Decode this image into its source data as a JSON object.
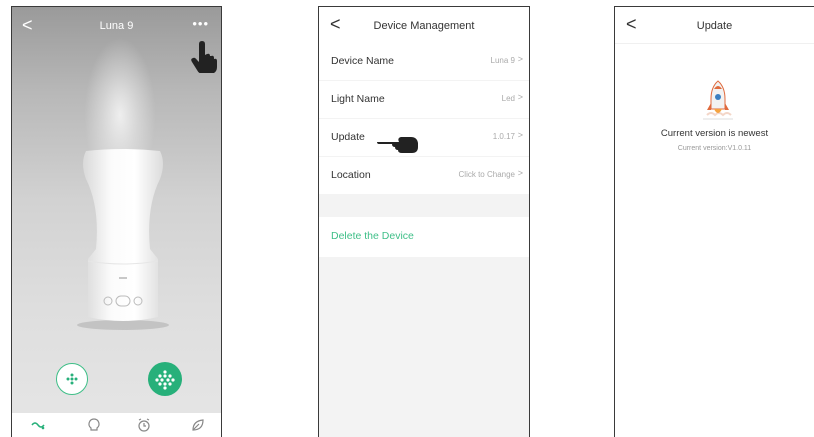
{
  "screen1": {
    "title": "Luna 9",
    "back_glyph": "<",
    "more_glyph": "•••",
    "icons": [
      "pointing-hand-icon",
      "mist-mode-icon",
      "light-mode-icon"
    ],
    "tabs": [
      "aroma-tab-icon",
      "light-bulb-tab-icon",
      "alarm-clock-tab-icon",
      "leaf-tab-icon"
    ],
    "accent": "#27b07a"
  },
  "screen2": {
    "title": "Device Management",
    "back_glyph": "<",
    "rows": [
      {
        "label": "Device Name",
        "value": "Luna 9"
      },
      {
        "label": "Light Name",
        "value": "Led"
      },
      {
        "label": "Update",
        "value": "1.0.17"
      },
      {
        "label": "Location",
        "value": "Click to Change"
      }
    ],
    "chevron": ">",
    "delete_label": "Delete the Device",
    "delete_color": "#3fbf88"
  },
  "screen3": {
    "title": "Update",
    "back_glyph": "<",
    "status": "Current version is newest",
    "version_text": "Current version:V1.0.11"
  }
}
